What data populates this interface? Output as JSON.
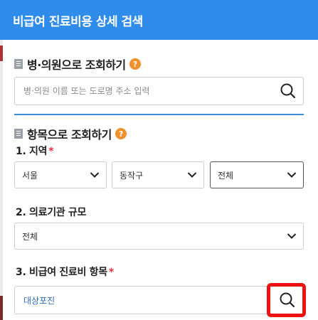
{
  "header": {
    "title": "비급여 진료비용 상세 검색"
  },
  "hospital_search": {
    "title": "병·의원으로 조회하기",
    "help": "?",
    "placeholder": "병·의원 이름 또는 도로명 주소 입력"
  },
  "item_search": {
    "title": "항목으로 조회하기",
    "help": "?",
    "region": {
      "label": "1. 지역",
      "required_mark": "*",
      "sido": "서울",
      "sigungu": "동작구",
      "dong": "전체"
    },
    "scale": {
      "label": "2. 의료기관 규모",
      "value": "전체"
    },
    "item": {
      "label": "3. 비급여 진료비 항목",
      "required_mark": "*",
      "value": "대상포진"
    }
  },
  "colors": {
    "header_bg": "#2f8ceb",
    "divider": "#3a8bd8",
    "required": "#e5323a",
    "help_badge": "#f0902a",
    "highlight": "#ee1111"
  }
}
